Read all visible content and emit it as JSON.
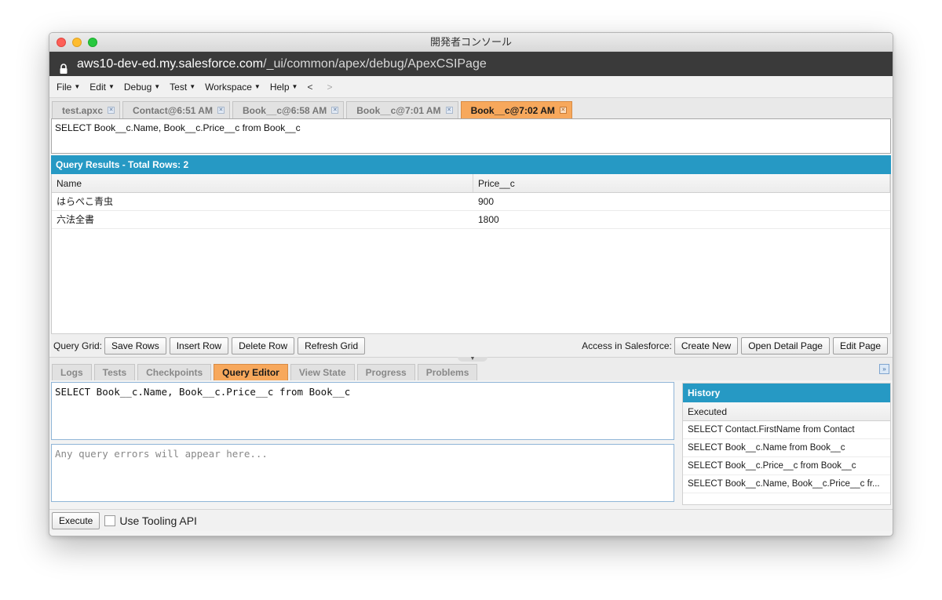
{
  "window": {
    "title": "開発者コンソール"
  },
  "url": {
    "host": "aws10-dev-ed.my.salesforce.com",
    "path": "/_ui/common/apex/debug/ApexCSIPage"
  },
  "menu": {
    "items": [
      "File",
      "Edit",
      "Debug",
      "Test",
      "Workspace",
      "Help"
    ],
    "back": "<",
    "forward": ">"
  },
  "file_tabs": [
    {
      "label": "test.apxc",
      "active": false
    },
    {
      "label": "Contact@6:51 AM",
      "active": false
    },
    {
      "label": "Book__c@6:58 AM",
      "active": false
    },
    {
      "label": "Book__c@7:01 AM",
      "active": false
    },
    {
      "label": "Book__c@7:02 AM",
      "active": true
    }
  ],
  "query_top": "SELECT Book__c.Name, Book__c.Price__c from Book__c",
  "results": {
    "header": "Query Results - Total Rows: 2",
    "columns": [
      "Name",
      "Price__c"
    ],
    "rows": [
      [
        "はらぺこ青虫",
        "900"
      ],
      [
        "六法全書",
        "1800"
      ]
    ]
  },
  "grid_toolbar": {
    "label": "Query Grid:",
    "left_buttons": [
      "Save Rows",
      "Insert Row",
      "Delete Row",
      "Refresh Grid"
    ],
    "right_label": "Access in Salesforce:",
    "right_buttons": [
      "Create New",
      "Open Detail Page",
      "Edit Page"
    ]
  },
  "bottom_tabs": [
    {
      "label": "Logs",
      "active": false
    },
    {
      "label": "Tests",
      "active": false
    },
    {
      "label": "Checkpoints",
      "active": false
    },
    {
      "label": "Query Editor",
      "active": true
    },
    {
      "label": "View State",
      "active": false
    },
    {
      "label": "Progress",
      "active": false
    },
    {
      "label": "Problems",
      "active": false
    }
  ],
  "editor": {
    "query": "SELECT Book__c.Name, Book__c.Price__c from Book__c",
    "errors_placeholder": "Any query errors will appear here..."
  },
  "history": {
    "title": "History",
    "column": "Executed",
    "items": [
      "SELECT Contact.FirstName from Contact",
      "SELECT Book__c.Name from Book__c",
      "SELECT Book__c.Price__c from Book__c",
      "SELECT Book__c.Name, Book__c.Price__c fr..."
    ]
  },
  "bottom_bar": {
    "execute_label": "Execute",
    "tooling_label": "Use Tooling API",
    "tooling_checked": false
  },
  "colors": {
    "accent_tab": "#f7a85c",
    "header_blue": "#2699c4",
    "url_bar": "#3a3a3a"
  }
}
